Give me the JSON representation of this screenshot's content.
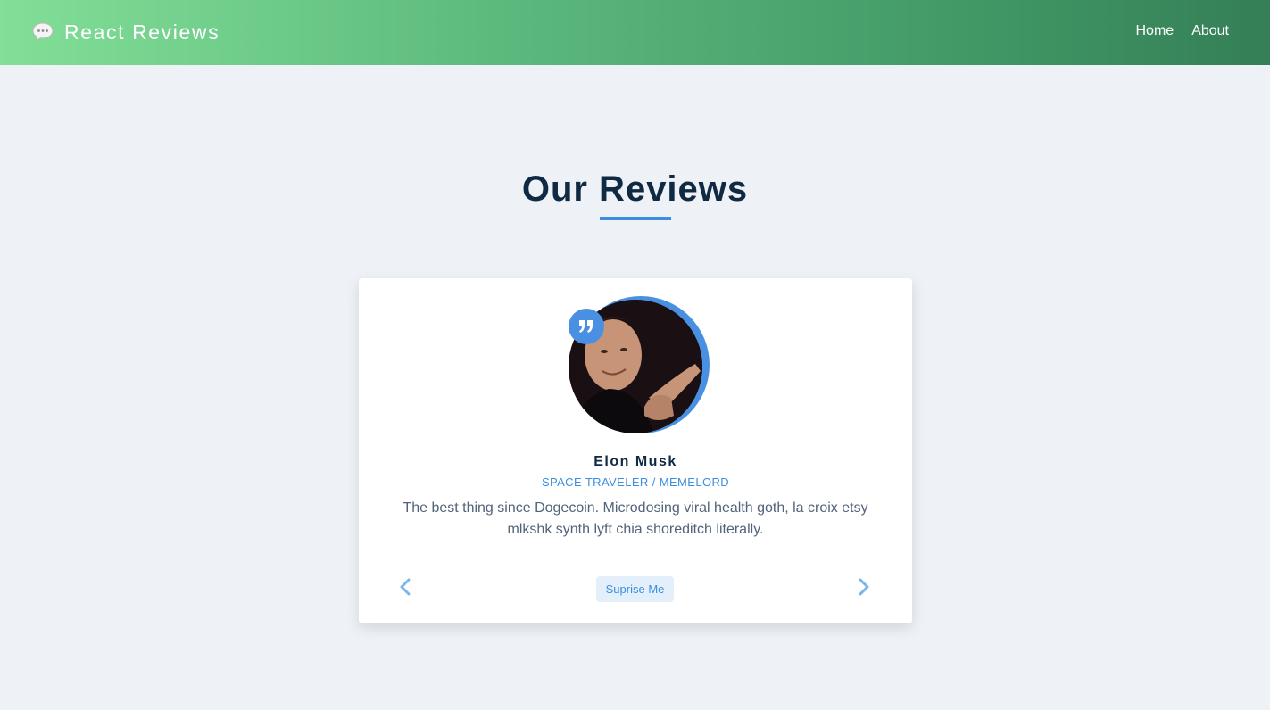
{
  "navbar": {
    "brand": "React Reviews",
    "brand_icon": "speech-bubble-icon",
    "links": [
      "Home",
      "About"
    ]
  },
  "main": {
    "title": "Our Reviews"
  },
  "review": {
    "name": "Elon Musk",
    "job": "SPACE TRAVELER / MEMELORD",
    "text": "The best thing since Dogecoin. Microdosing viral health goth, la croix etsy mlkshk synth lyft chia shoreditch literally.",
    "random_label": "Suprise Me",
    "quote_icon": "quote-icon",
    "prev_icon": "chevron-left-icon",
    "next_icon": "chevron-right-icon"
  },
  "colors": {
    "accent": "#4a90e2",
    "heading": "#102a43",
    "nav_gradient_start": "#82df97",
    "nav_gradient_end": "#357e57",
    "background": "#eef2f7"
  }
}
